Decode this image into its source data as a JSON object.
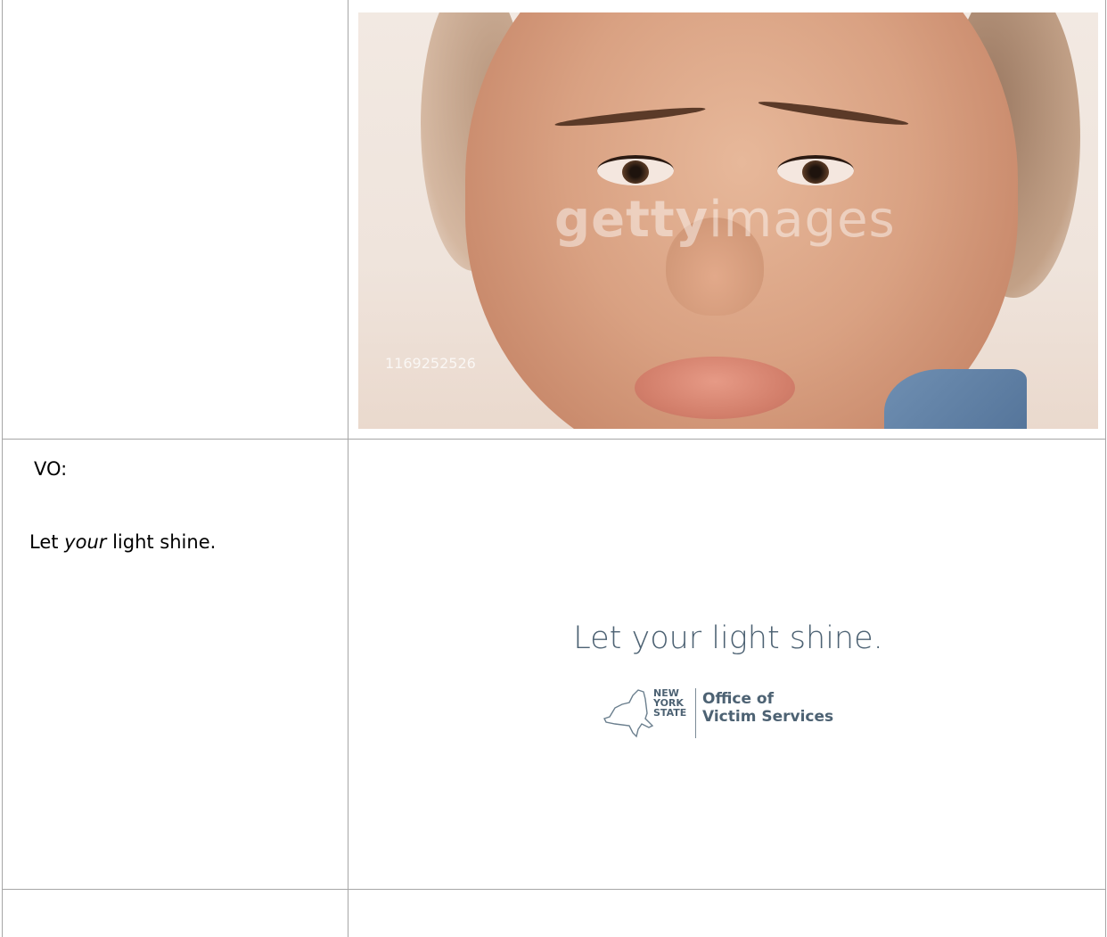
{
  "rows": [
    {
      "left": {
        "heading": "",
        "body": ""
      },
      "right": {
        "image": {
          "watermark_brand_bold": "getty",
          "watermark_brand_light": "images",
          "watermark_id": "1169252526"
        }
      }
    },
    {
      "left": {
        "heading": "VO:",
        "body_prefix": "Let ",
        "body_emphasis": "your",
        "body_suffix": " light shine."
      },
      "right": {
        "end_card_title": "Let your light shine.",
        "logo_state_lines": [
          "NEW",
          "YORK",
          "STATE"
        ],
        "logo_office_lines": [
          "Office of",
          "Victim Services"
        ]
      }
    },
    {
      "left": {
        "heading": "",
        "body": ""
      },
      "right": {}
    }
  ],
  "colors": {
    "grid": "#a6a6a6",
    "end_card_text": "#4d6273"
  }
}
